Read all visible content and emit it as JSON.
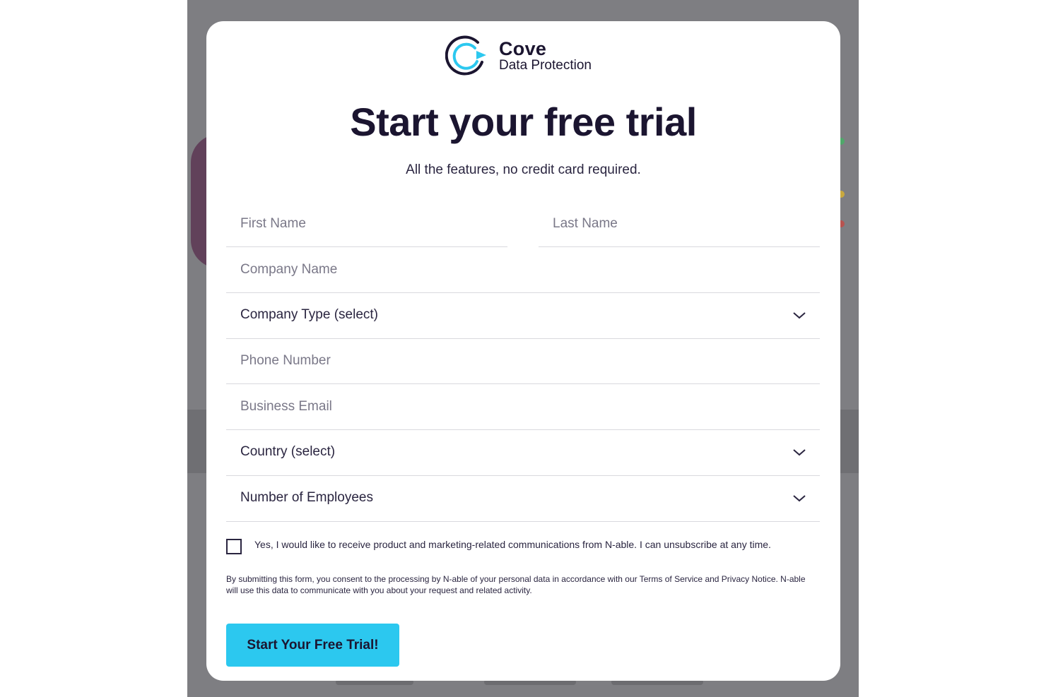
{
  "brand": {
    "name": "Cove",
    "subname": "Data Protection",
    "accent_color": "#2cc8ef",
    "dark_color": "#1b1530",
    "logo_icon": "cove-logo-icon"
  },
  "header": {
    "title": "Start your free trial",
    "subtitle": "All the features, no credit card required."
  },
  "form": {
    "first_name": {
      "placeholder": "First Name",
      "value": ""
    },
    "last_name": {
      "placeholder": "Last Name",
      "value": ""
    },
    "company_name": {
      "placeholder": "Company Name",
      "value": ""
    },
    "company_type": {
      "selected": "Company Type (select)",
      "icon": "chevron-down-icon"
    },
    "phone": {
      "placeholder": "Phone Number",
      "value": ""
    },
    "email": {
      "placeholder": "Business Email",
      "value": ""
    },
    "country": {
      "selected": "Country (select)",
      "icon": "chevron-down-icon"
    },
    "employees": {
      "selected": "Number of Employees",
      "icon": "chevron-down-icon"
    },
    "consent_text": "Yes, I would like to receive product and marketing-related communications from N-able. I can unsubscribe at any time.",
    "consent_checked": false,
    "legal_text": "By submitting this form, you consent to the processing by N-able of your personal data in accordance with our Terms of Service and Privacy Notice. N-able will use this data to communicate with you about your request and related activity.",
    "submit_label": "Start Your Free Trial!"
  }
}
